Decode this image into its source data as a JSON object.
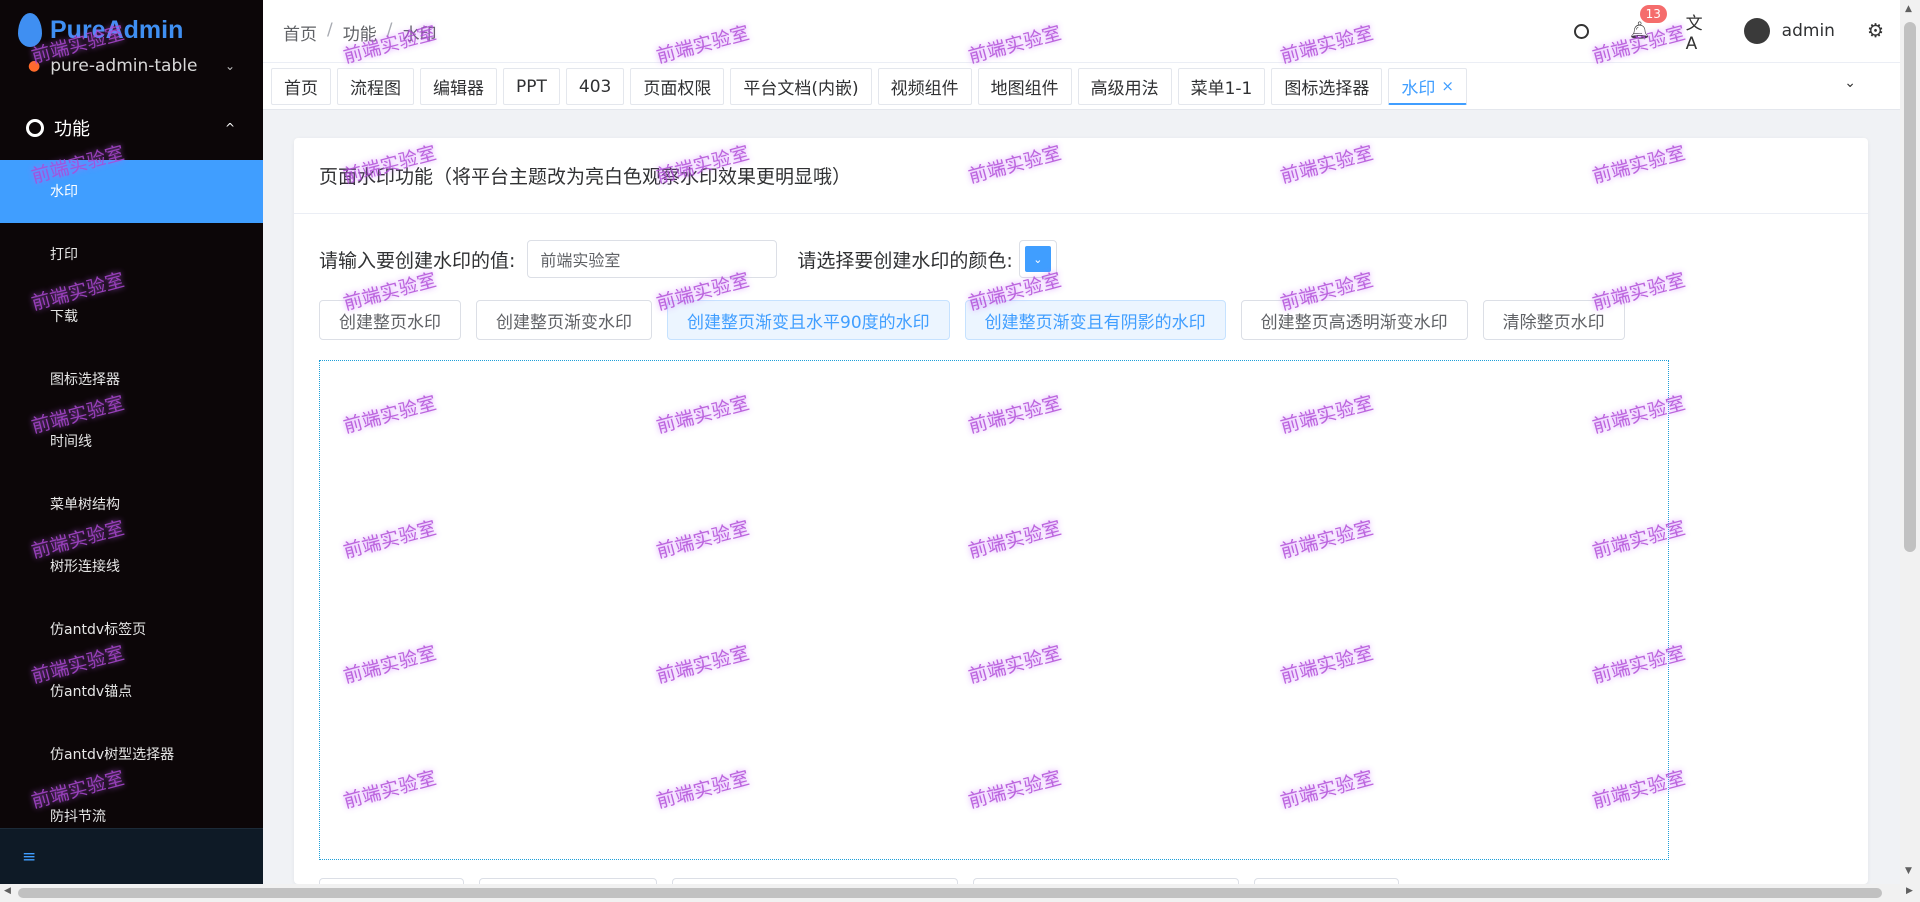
{
  "app": {
    "name": "PureAdmin"
  },
  "sidebar": {
    "top_item": "pure-admin-table",
    "group": "功能",
    "items": [
      {
        "label": "水印",
        "active": true
      },
      {
        "label": "打印"
      },
      {
        "label": "下载"
      },
      {
        "label": "图标选择器"
      },
      {
        "label": "时间线"
      },
      {
        "label": "菜单树结构"
      },
      {
        "label": "树形连接线"
      },
      {
        "label": "仿antdv标签页"
      },
      {
        "label": "仿antdv锚点"
      },
      {
        "label": "仿antdv树型选择器"
      },
      {
        "label": "防抖节流"
      }
    ]
  },
  "header": {
    "breadcrumb": [
      "首页",
      "功能",
      "水印"
    ],
    "breadcrumb_sep": "/",
    "notification_count": "13",
    "username": "admin"
  },
  "tabs": [
    {
      "label": "首页"
    },
    {
      "label": "流程图"
    },
    {
      "label": "编辑器"
    },
    {
      "label": "PPT"
    },
    {
      "label": "403"
    },
    {
      "label": "页面权限"
    },
    {
      "label": "平台文档(内嵌)"
    },
    {
      "label": "视频组件"
    },
    {
      "label": "地图组件"
    },
    {
      "label": "高级用法"
    },
    {
      "label": "菜单1-1"
    },
    {
      "label": "图标选择器"
    },
    {
      "label": "水印",
      "active": true
    }
  ],
  "card": {
    "title": "页面水印功能（将平台主题改为亮白色观察水印效果更明显哦）",
    "input_label": "请输入要创建水印的值:",
    "input_value": "前端实验室",
    "color_label": "请选择要创建水印的颜色:",
    "color_value": "#409eff",
    "buttons": [
      {
        "label": "创建整页水印"
      },
      {
        "label": "创建整页渐变水印"
      },
      {
        "label": "创建整页渐变且水平90度的水印",
        "style": "light"
      },
      {
        "label": "创建整页渐变且有阴影的水印",
        "style": "light"
      },
      {
        "label": "创建整页高透明渐变水印"
      },
      {
        "label": "清除整页水印"
      }
    ]
  },
  "watermark_text": "前端实验室"
}
